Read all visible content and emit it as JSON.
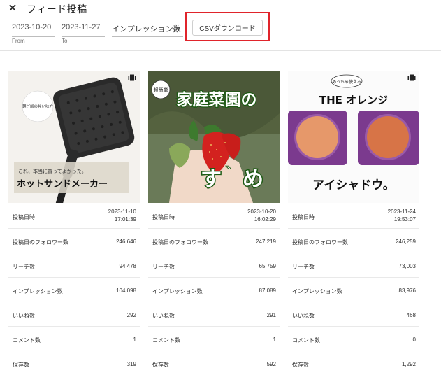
{
  "header": {
    "title": "フィード投稿",
    "close_icon": "close-icon"
  },
  "filters": {
    "from": {
      "value": "2023-10-20",
      "helper": "From"
    },
    "to": {
      "value": "2023-11-27",
      "helper": "To"
    },
    "sort_select": {
      "value": "インプレッション数"
    },
    "csv_button": "CSVダウンロード"
  },
  "stat_labels": [
    "投稿日時",
    "投稿日のフォロワー数",
    "リーチ数",
    "インプレッション数",
    "いいね数",
    "コメント数",
    "保存数"
  ],
  "posts": [
    {
      "image": {
        "alt_labels": [
          "朝ご飯の強い味方",
          "これ、本当に買ってよかった。",
          "ホットサンドメーカー"
        ],
        "carousel_icon": "carousel-icon"
      },
      "date": "2023-11-10",
      "time": "17:01:39",
      "followers": "246,646",
      "reach": "94,478",
      "impressions": "104,098",
      "likes": "292",
      "comments": "1",
      "saves": "319"
    },
    {
      "image": {
        "alt_labels": [
          "超簡単",
          "家庭菜園の",
          "す",
          "め"
        ]
      },
      "date": "2023-10-20",
      "time": "16:02:29",
      "followers": "247,219",
      "reach": "65,759",
      "impressions": "87,089",
      "likes": "291",
      "comments": "1",
      "saves": "592"
    },
    {
      "image": {
        "alt_labels": [
          "めっちゃ使える",
          "THE オレンジ",
          "アイシャドウ。"
        ],
        "carousel_icon": "carousel-icon"
      },
      "date": "2023-11-24",
      "time": "19:53:07",
      "followers": "246,259",
      "reach": "73,003",
      "impressions": "83,976",
      "likes": "468",
      "comments": "0",
      "saves": "1,292"
    }
  ],
  "colors": {
    "highlight": "#e0242b",
    "divider": "#e3e3e3"
  }
}
